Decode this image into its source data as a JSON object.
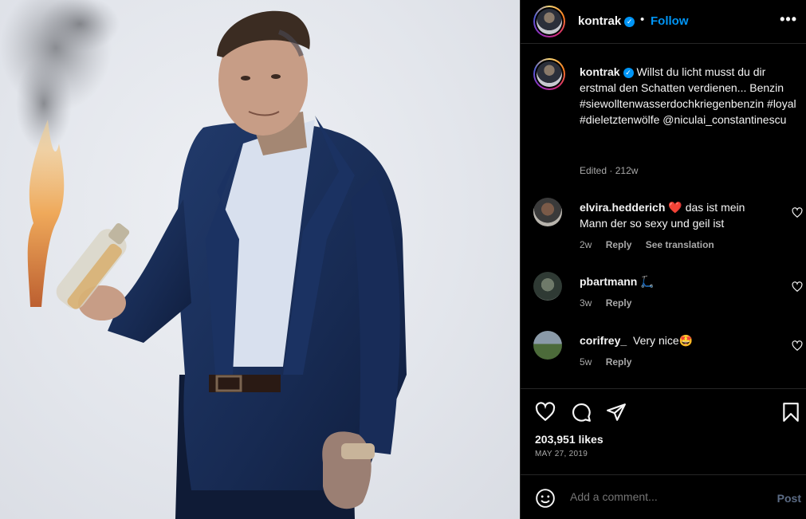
{
  "post": {
    "username": "kontrak",
    "follow_label": "Follow",
    "dot": "•",
    "more": "•••"
  },
  "caption": {
    "username": "kontrak",
    "text": "Willst du licht musst du dir erstmal den Schatten verdienen... Benzin #siewolltenwasserdochkriegenbenzin #loyal #dieletztenwölfe @niculai_constantinescu",
    "edited": "Edited",
    "sep": "·",
    "age": "212w"
  },
  "comments": [
    {
      "username": "elvira.hedderich",
      "emoji": "❤️",
      "text": "das ist mein Mann der so sexy und geil ist",
      "age": "2w",
      "reply": "Reply",
      "translate": "See translation"
    },
    {
      "username": "pbartmann",
      "emoji": "🛴",
      "text": "",
      "age": "3w",
      "reply": "Reply"
    },
    {
      "username": "corifrey_",
      "emoji": "",
      "text": "Very nice🤩",
      "age": "5w",
      "reply": "Reply"
    }
  ],
  "stats": {
    "likes": "203,951 likes",
    "date": "MAY 27, 2019"
  },
  "composer": {
    "placeholder": "Add a comment...",
    "post_label": "Post"
  },
  "icons": [
    "more-icon",
    "verified-icon",
    "heart-icon",
    "comment-icon",
    "share-icon",
    "save-icon",
    "emoji-icon"
  ],
  "colors": {
    "accent": "#0095f6",
    "background": "#000000",
    "muted": "#a8a8a8",
    "post_disabled": "#5b6b84",
    "heart_red": "#ed4956"
  }
}
